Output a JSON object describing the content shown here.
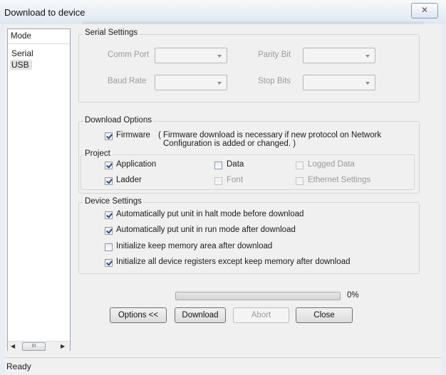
{
  "window": {
    "title": "Download to device",
    "close_glyph": "✕"
  },
  "mode_panel": {
    "header": "Mode",
    "items": [
      {
        "label": "Serial",
        "selected": false
      },
      {
        "label": "USB",
        "selected": true
      }
    ],
    "scroll_thumb": "III"
  },
  "serial_settings": {
    "title": "Serial Settings",
    "comm_port_label": "Comm Port",
    "baud_rate_label": "Baud Rate",
    "parity_bit_label": "Parity Bit",
    "stop_bits_label": "Stop Bits"
  },
  "download_options": {
    "title": "Download Options",
    "firmware_label": "Firmware",
    "firmware_checked": true,
    "firmware_note_line1": "( Firmware download is necessary if new protocol on Network",
    "firmware_note_line2": "Configuration is added or changed. )",
    "project_title": "Project",
    "application_label": "Application",
    "ladder_label": "Ladder",
    "data_label": "Data",
    "font_label": "Font",
    "logged_data_label": "Logged Data",
    "ethernet_settings_label": "Ethernet Settings"
  },
  "device_settings": {
    "title": "Device Settings",
    "options": [
      {
        "label": "Automatically put unit in halt mode before download",
        "checked": true
      },
      {
        "label": "Automatically put unit in run mode after download",
        "checked": true
      },
      {
        "label": "Initialize keep memory area after download",
        "checked": false
      },
      {
        "label": "Initialize all device registers except keep memory after download",
        "checked": true
      }
    ]
  },
  "progress": {
    "percent_text": "0%",
    "value": 0
  },
  "buttons": {
    "options": "Options <<",
    "download": "Download",
    "abort": "Abort",
    "close": "Close"
  },
  "status": {
    "text": "Ready"
  }
}
